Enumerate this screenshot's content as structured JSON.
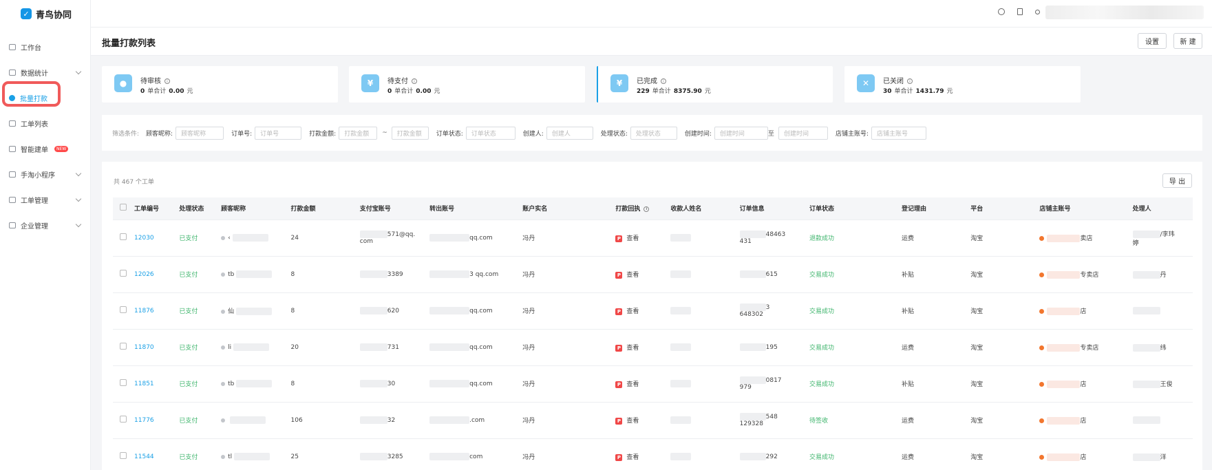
{
  "app": {
    "name": "青鸟协同",
    "logo_char": "✓"
  },
  "sidebar": {
    "items": [
      {
        "label": "工作台",
        "icon": "workbench-icon",
        "expandable": false
      },
      {
        "label": "数据统计",
        "icon": "chart-icon",
        "expandable": true
      },
      {
        "label": "批量打款",
        "icon": "batch-pay-icon",
        "expandable": false,
        "active": true
      },
      {
        "label": "工单列表",
        "icon": "order-list-icon",
        "expandable": false
      },
      {
        "label": "智能建单",
        "icon": "smart-order-icon",
        "expandable": false,
        "badge": "NEW"
      },
      {
        "label": "手淘小程序",
        "icon": "miniapp-icon",
        "expandable": true
      },
      {
        "label": "工单管理",
        "icon": "order-manage-icon",
        "expandable": true
      },
      {
        "label": "企业管理",
        "icon": "enterprise-icon",
        "expandable": true
      }
    ]
  },
  "header": {
    "title": "批量打款列表",
    "settings_label": "设置",
    "new_label": "新 建"
  },
  "cards": [
    {
      "title": "待审核",
      "count": "0",
      "unit_orders": "单合计",
      "amount": "0.00",
      "currency": "元",
      "icon_char": "●"
    },
    {
      "title": "待支付",
      "count": "0",
      "unit_orders": "单合计",
      "amount": "0.00",
      "currency": "元",
      "icon_char": "¥"
    },
    {
      "title": "已完成",
      "count": "229",
      "unit_orders": "单合计",
      "amount": "8375.90",
      "currency": "元",
      "icon_char": "¥"
    },
    {
      "title": "已关闭",
      "count": "30",
      "unit_orders": "单合计",
      "amount": "1431.79",
      "currency": "元",
      "icon_char": "✕"
    }
  ],
  "filter": {
    "label": "筛选条件:",
    "fields": [
      {
        "label": "顾客昵称:",
        "placeholder": "顾客昵称"
      },
      {
        "label": "订单号:",
        "placeholder": "订单号"
      },
      {
        "label": "打款金额:",
        "placeholder": "打款金额",
        "placeholder2": "打款金额",
        "separator": "~"
      },
      {
        "label": "订单状态:",
        "placeholder": "订单状态"
      },
      {
        "label": "创建人:",
        "placeholder": "创建人"
      },
      {
        "label": "处理状态:",
        "placeholder": "处理状态"
      },
      {
        "label": "创建时间:",
        "placeholder": "创建时间",
        "separator": "至",
        "placeholder2": "创建时间"
      },
      {
        "label": "店铺主账号:",
        "placeholder": "店铺主账号"
      }
    ]
  },
  "table": {
    "total": "共 467 个工单",
    "export_label": "导 出",
    "columns": [
      "工单编号",
      "处理状态",
      "顾客昵称",
      "打款金额",
      "支付宝账号",
      "转出账号",
      "账户实名",
      "打款回执",
      "收款人姓名",
      "订单信息",
      "订单状态",
      "登记理由",
      "平台",
      "店铺主账号",
      "处理人"
    ],
    "receipt_action": "查看",
    "rows": [
      {
        "id": "12030",
        "status": "已支付",
        "nick": "‹",
        "amount": "24",
        "alipay": "571@qq.",
        "alipay2": "com",
        "out": "qq.com",
        "realname": "冯丹",
        "order_a": "48463",
        "order_b": "431",
        "order_status": "退款成功",
        "reason": "运费",
        "platform": "淘宝",
        "shop": "卖店",
        "handler": "/李玮",
        "handler2": "婷"
      },
      {
        "id": "12026",
        "status": "已支付",
        "nick": "tb",
        "amount": "8",
        "alipay": "3389",
        "alipay2": "",
        "out": "3 qq.com",
        "realname": "冯丹",
        "order_a": "615",
        "order_b": "",
        "order_status": "交易成功",
        "reason": "补贴",
        "platform": "淘宝",
        "shop": "专卖店",
        "handler": "丹",
        "handler2": ""
      },
      {
        "id": "11876",
        "status": "已支付",
        "nick": "仙",
        "amount": "8",
        "alipay": "620",
        "alipay2": "",
        "out": "qq.com",
        "realname": "冯丹",
        "order_a": "3",
        "order_b": "648302",
        "order_status": "交易成功",
        "reason": "补贴",
        "platform": "淘宝",
        "shop": "店",
        "handler": "",
        "handler2": ""
      },
      {
        "id": "11870",
        "status": "已支付",
        "nick": "li",
        "amount": "20",
        "alipay": "731",
        "alipay2": "",
        "out": "qq.com",
        "realname": "冯丹",
        "order_a": "195",
        "order_b": "",
        "order_status": "交易成功",
        "reason": "运费",
        "platform": "淘宝",
        "shop": "专卖店",
        "handler": "纬",
        "handler2": ""
      },
      {
        "id": "11851",
        "status": "已支付",
        "nick": "tb",
        "amount": "8",
        "alipay": "30",
        "alipay2": "",
        "out": "qq.com",
        "realname": "冯丹",
        "order_a": "0817",
        "order_b": "979",
        "order_status": "交易成功",
        "reason": "补贴",
        "platform": "淘宝",
        "shop": "店",
        "handler": "王俊",
        "handler2": ""
      },
      {
        "id": "11776",
        "status": "已支付",
        "nick": "",
        "amount": "106",
        "alipay": "32",
        "alipay2": "",
        "out": ".com",
        "realname": "冯丹",
        "order_a": "548",
        "order_b": "129328",
        "order_status": "待签收",
        "reason": "运费",
        "platform": "淘宝",
        "shop": "店",
        "handler": "",
        "handler2": ""
      },
      {
        "id": "11544",
        "status": "已支付",
        "nick": "tl",
        "amount": "25",
        "alipay": "3285",
        "alipay2": "",
        "out": "com",
        "realname": "冯丹",
        "order_a": "292",
        "order_b": "",
        "order_status": "交易成功",
        "reason": "运费",
        "platform": "淘宝",
        "shop": "店",
        "handler": "洋",
        "handler2": ""
      }
    ]
  },
  "colors": {
    "accent": "#1aa0e6",
    "success": "#3fb56d",
    "highlight": "#f05a5a",
    "receipt": "#f04848"
  }
}
